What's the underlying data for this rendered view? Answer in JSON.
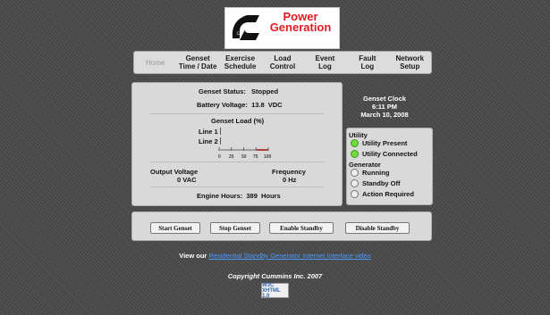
{
  "logo": {
    "line1": "Power",
    "line2": "Generation",
    "mark": "Cummins"
  },
  "nav": [
    {
      "label": "Home",
      "active": true
    },
    {
      "label": "Genset\nTime / Date",
      "active": false
    },
    {
      "label": "Exercise\nSchedule",
      "active": false
    },
    {
      "label": "Load\nControl",
      "active": false
    },
    {
      "label": "Event\nLog",
      "active": false
    },
    {
      "label": "Fault\nLog",
      "active": false
    },
    {
      "label": "Network\nSetup",
      "active": false
    }
  ],
  "main": {
    "status_label": "Genset Status:",
    "status_value": "Stopped",
    "battery_label": "Battery Voltage:",
    "battery_value": "13.8",
    "battery_unit": "VDC",
    "load_title": "Genset Load (%)",
    "line1_label": "Line 1",
    "line2_label": "Line 2",
    "scale_ticks": [
      "0",
      "25",
      "50",
      "75",
      "100"
    ],
    "output_voltage_label": "Output Voltage",
    "output_voltage_value": "0 VAC",
    "frequency_label": "Frequency",
    "frequency_value": "0 Hz",
    "engine_hours_label": "Engine Hours:",
    "engine_hours_value": "389",
    "engine_hours_unit": "Hours"
  },
  "clock": {
    "title": "Genset Clock",
    "time": "6:11 PM",
    "date": "March 10, 2008"
  },
  "status": {
    "utility_heading": "Utility",
    "utility_present": "Utility Present",
    "utility_connected": "Utility Connected",
    "generator_heading": "Generator",
    "running": "Running",
    "standby_off": "Standby Off",
    "action_required": "Action Required"
  },
  "buttons": {
    "start": "Start Genset",
    "stop": "Stop Genset",
    "enable_standby": "Enable Standby",
    "disable_standby": "Disable Standby"
  },
  "footer": {
    "view_prefix": "View our",
    "link_text": "Residential Standby Generator Internet Interface video",
    "copyright": "Copyright Cummins Inc. 2007",
    "badge": "W3C XHTML 1.0"
  },
  "colors": {
    "brand_red": "#e31b23",
    "led_on": "#6fdc3a",
    "link": "#4a9aff"
  }
}
